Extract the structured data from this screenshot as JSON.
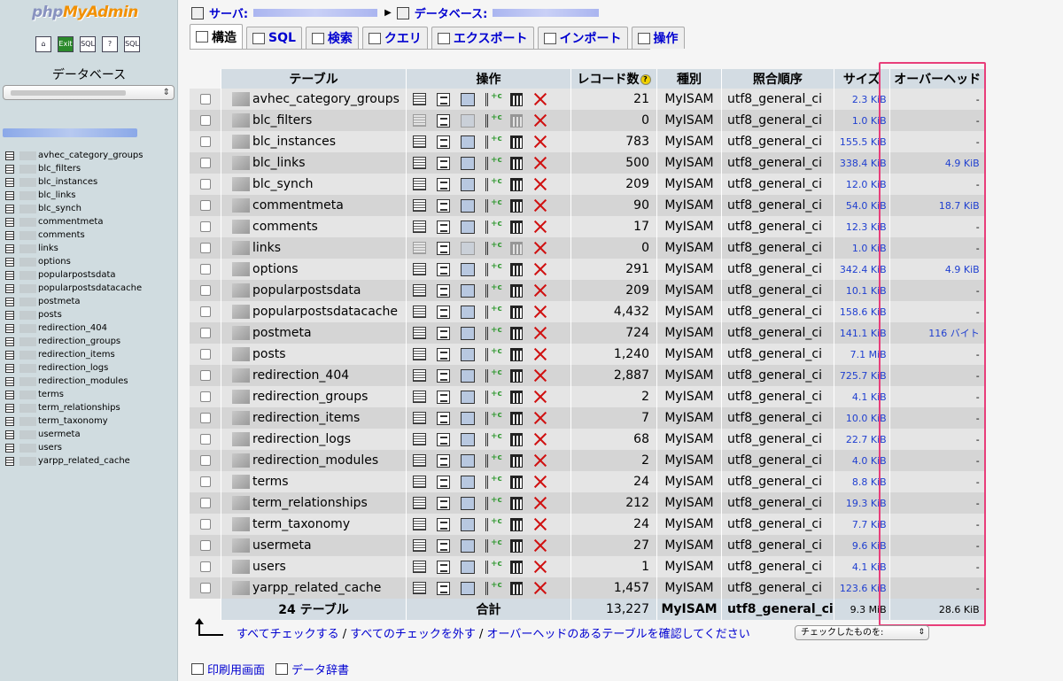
{
  "app": {
    "logo_php": "php",
    "logo_myadmin": "MyAdmin"
  },
  "sidebar": {
    "nav_icons": [
      {
        "name": "home-icon",
        "glyph": "⌂"
      },
      {
        "name": "exit-icon",
        "glyph": "Exit"
      },
      {
        "name": "sql-query-icon",
        "glyph": "SQL"
      },
      {
        "name": "docs-icon",
        "glyph": "?"
      },
      {
        "name": "sql-docs-icon",
        "glyph": "SQL"
      }
    ],
    "database_label": "データベース",
    "tables": [
      "avhec_category_groups",
      "blc_filters",
      "blc_instances",
      "blc_links",
      "blc_synch",
      "commentmeta",
      "comments",
      "links",
      "options",
      "popularpostsdata",
      "popularpostsdatacache",
      "postmeta",
      "posts",
      "redirection_404",
      "redirection_groups",
      "redirection_items",
      "redirection_logs",
      "redirection_modules",
      "terms",
      "term_relationships",
      "term_taxonomy",
      "usermeta",
      "users",
      "yarpp_related_cache"
    ]
  },
  "breadcrumb": {
    "server_label": "サーバ:",
    "database_label": "データベース:"
  },
  "tabs": [
    {
      "label": "構造",
      "icon": "structure-icon",
      "active": true
    },
    {
      "label": "SQL",
      "icon": "sql-icon",
      "active": false
    },
    {
      "label": "検索",
      "icon": "search-icon",
      "active": false
    },
    {
      "label": "クエリ",
      "icon": "query-icon",
      "active": false
    },
    {
      "label": "エクスポート",
      "icon": "export-icon",
      "active": false
    },
    {
      "label": "インポート",
      "icon": "import-icon",
      "active": false
    },
    {
      "label": "操作",
      "icon": "operations-icon",
      "active": false
    }
  ],
  "table": {
    "headers": {
      "table": "テーブル",
      "action": "操作",
      "records": "レコード数",
      "type": "種別",
      "collation": "照合順序",
      "size": "サイズ",
      "overhead": "オーバーヘッド"
    },
    "rows": [
      {
        "name": "avhec_category_groups",
        "records": "21",
        "type": "MyISAM",
        "collation": "utf8_general_ci",
        "size": "2.3 KiB",
        "overhead": "-",
        "empty": false
      },
      {
        "name": "blc_filters",
        "records": "0",
        "type": "MyISAM",
        "collation": "utf8_general_ci",
        "size": "1.0 KiB",
        "overhead": "-",
        "empty": true
      },
      {
        "name": "blc_instances",
        "records": "783",
        "type": "MyISAM",
        "collation": "utf8_general_ci",
        "size": "155.5 KiB",
        "overhead": "-",
        "empty": false
      },
      {
        "name": "blc_links",
        "records": "500",
        "type": "MyISAM",
        "collation": "utf8_general_ci",
        "size": "338.4 KiB",
        "overhead": "4.9 KiB",
        "empty": false
      },
      {
        "name": "blc_synch",
        "records": "209",
        "type": "MyISAM",
        "collation": "utf8_general_ci",
        "size": "12.0 KiB",
        "overhead": "-",
        "empty": false
      },
      {
        "name": "commentmeta",
        "records": "90",
        "type": "MyISAM",
        "collation": "utf8_general_ci",
        "size": "54.0 KiB",
        "overhead": "18.7 KiB",
        "empty": false
      },
      {
        "name": "comments",
        "records": "17",
        "type": "MyISAM",
        "collation": "utf8_general_ci",
        "size": "12.3 KiB",
        "overhead": "-",
        "empty": false
      },
      {
        "name": "links",
        "records": "0",
        "type": "MyISAM",
        "collation": "utf8_general_ci",
        "size": "1.0 KiB",
        "overhead": "-",
        "empty": true
      },
      {
        "name": "options",
        "records": "291",
        "type": "MyISAM",
        "collation": "utf8_general_ci",
        "size": "342.4 KiB",
        "overhead": "4.9 KiB",
        "empty": false
      },
      {
        "name": "popularpostsdata",
        "records": "209",
        "type": "MyISAM",
        "collation": "utf8_general_ci",
        "size": "10.1 KiB",
        "overhead": "-",
        "empty": false
      },
      {
        "name": "popularpostsdatacache",
        "records": "4,432",
        "type": "MyISAM",
        "collation": "utf8_general_ci",
        "size": "158.6 KiB",
        "overhead": "-",
        "empty": false
      },
      {
        "name": "postmeta",
        "records": "724",
        "type": "MyISAM",
        "collation": "utf8_general_ci",
        "size": "141.1 KiB",
        "overhead": "116 バイト",
        "empty": false
      },
      {
        "name": "posts",
        "records": "1,240",
        "type": "MyISAM",
        "collation": "utf8_general_ci",
        "size": "7.1 MiB",
        "overhead": "-",
        "empty": false
      },
      {
        "name": "redirection_404",
        "records": "2,887",
        "type": "MyISAM",
        "collation": "utf8_general_ci",
        "size": "725.7 KiB",
        "overhead": "-",
        "empty": false
      },
      {
        "name": "redirection_groups",
        "records": "2",
        "type": "MyISAM",
        "collation": "utf8_general_ci",
        "size": "4.1 KiB",
        "overhead": "-",
        "empty": false
      },
      {
        "name": "redirection_items",
        "records": "7",
        "type": "MyISAM",
        "collation": "utf8_general_ci",
        "size": "10.0 KiB",
        "overhead": "-",
        "empty": false
      },
      {
        "name": "redirection_logs",
        "records": "68",
        "type": "MyISAM",
        "collation": "utf8_general_ci",
        "size": "22.7 KiB",
        "overhead": "-",
        "empty": false
      },
      {
        "name": "redirection_modules",
        "records": "2",
        "type": "MyISAM",
        "collation": "utf8_general_ci",
        "size": "4.0 KiB",
        "overhead": "-",
        "empty": false
      },
      {
        "name": "terms",
        "records": "24",
        "type": "MyISAM",
        "collation": "utf8_general_ci",
        "size": "8.8 KiB",
        "overhead": "-",
        "empty": false
      },
      {
        "name": "term_relationships",
        "records": "212",
        "type": "MyISAM",
        "collation": "utf8_general_ci",
        "size": "19.3 KiB",
        "overhead": "-",
        "empty": false
      },
      {
        "name": "term_taxonomy",
        "records": "24",
        "type": "MyISAM",
        "collation": "utf8_general_ci",
        "size": "7.7 KiB",
        "overhead": "-",
        "empty": false
      },
      {
        "name": "usermeta",
        "records": "27",
        "type": "MyISAM",
        "collation": "utf8_general_ci",
        "size": "9.6 KiB",
        "overhead": "-",
        "empty": false
      },
      {
        "name": "users",
        "records": "1",
        "type": "MyISAM",
        "collation": "utf8_general_ci",
        "size": "4.1 KiB",
        "overhead": "-",
        "empty": false
      },
      {
        "name": "yarpp_related_cache",
        "records": "1,457",
        "type": "MyISAM",
        "collation": "utf8_general_ci",
        "size": "123.6 KiB",
        "overhead": "-",
        "empty": false
      }
    ],
    "footer": {
      "count": "24 テーブル",
      "total_label": "合計",
      "records": "13,227",
      "type": "MyISAM",
      "collation": "utf8_general_ci",
      "size": "9.3 MiB",
      "overhead": "28.6 KiB"
    }
  },
  "bottom": {
    "check_all": "すべてチェックする",
    "separator": "/",
    "uncheck_all": "すべてのチェックを外す",
    "check_overhead": "オーバーヘッドのあるテーブルを確認してください",
    "with_selected": "チェックしたものを:"
  },
  "footer_links": {
    "print_view": "印刷用画面",
    "data_dictionary": "データ辞書"
  },
  "colors": {
    "link": "#0000d0",
    "highlight_border": "#e83e7a",
    "header_bg": "#d3dce3",
    "drop_red": "#d01010"
  }
}
